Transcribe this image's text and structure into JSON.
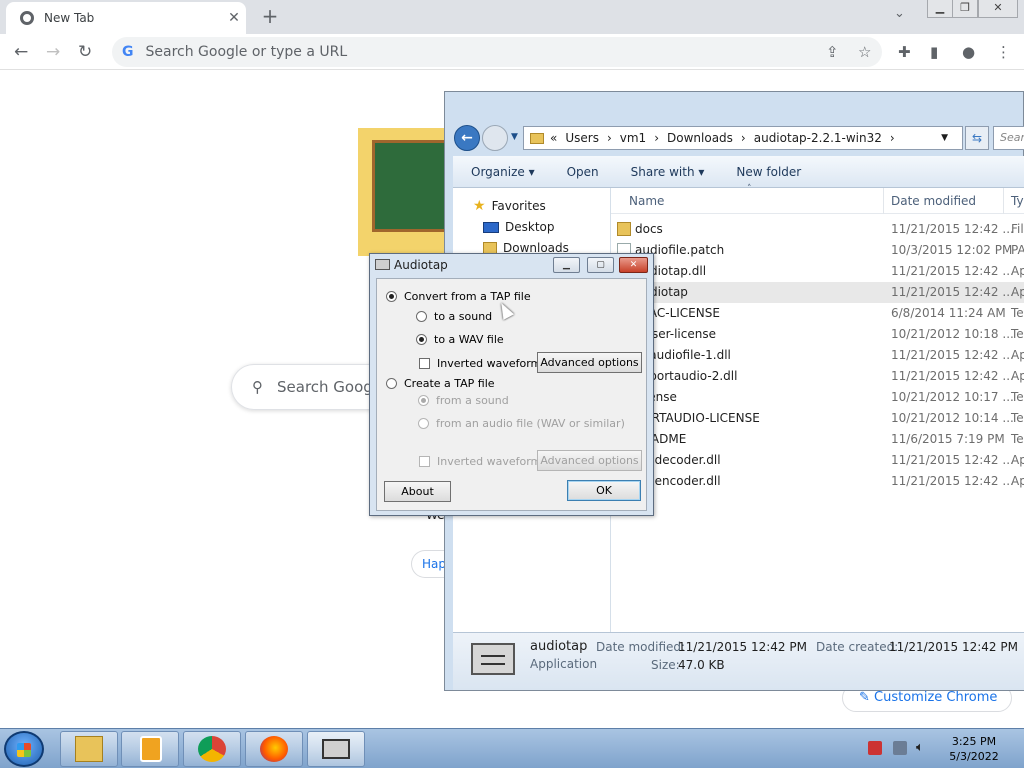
{
  "browser": {
    "tab_title": "New Tab",
    "tab_close": "✕",
    "new_tab": "+",
    "tab_menu": "⌄",
    "omnibox_placeholder": "Search Google or type a URL",
    "ntp_search_placeholder": "Search Goog",
    "peek_text": "We",
    "peek_chip": "Hap",
    "customize_label": "Customize Chrome"
  },
  "explorer": {
    "breadcrumb": [
      "«",
      "Users",
      "›",
      "vm1",
      "›",
      "Downloads",
      "›",
      "audiotap-2.2.1-win32",
      "›"
    ],
    "search_placeholder": "Search",
    "toolbar": [
      "Organize ▾",
      "Open",
      "Share with ▾",
      "New folder"
    ],
    "nav": {
      "favorites": "Favorites",
      "desktop": "Desktop",
      "downloads": "Downloads"
    },
    "columns": {
      "name": "Name",
      "date": "Date modified",
      "type": "Ty"
    },
    "files": [
      {
        "name": "docs",
        "date": "11/21/2015 12:42 ...",
        "type": "File",
        "icon": "folder"
      },
      {
        "name": "audiofile.patch",
        "date": "10/3/2015 12:02 PM",
        "type": "PA",
        "icon": "doc"
      },
      {
        "name": "audiotap.dll",
        "date": "11/21/2015 12:42 ...",
        "type": "Ap",
        "icon": "doc"
      },
      {
        "name": "audiotap",
        "date": "11/21/2015 12:42 ...",
        "type": "Ap",
        "icon": "app",
        "selected": true
      },
      {
        "name": "FLAC-LICENSE",
        "date": "6/8/2014 11:24 AM",
        "type": "Te",
        "icon": "doc"
      },
      {
        "name": "lesser-license",
        "date": "10/21/2012 10:18 ...",
        "type": "Te",
        "icon": "doc"
      },
      {
        "name": "libaudiofile-1.dll",
        "date": "11/21/2015 12:42 ...",
        "type": "Ap",
        "icon": "doc"
      },
      {
        "name": "libportaudio-2.dll",
        "date": "11/21/2015 12:42 ...",
        "type": "Ap",
        "icon": "doc"
      },
      {
        "name": "license",
        "date": "10/21/2012 10:17 ...",
        "type": "Te",
        "icon": "doc"
      },
      {
        "name": "PORTAUDIO-LICENSE",
        "date": "10/21/2012 10:14 ...",
        "type": "Te",
        "icon": "doc"
      },
      {
        "name": "README",
        "date": "11/6/2015 7:19 PM",
        "type": "Te",
        "icon": "doc"
      },
      {
        "name": "tapdecoder.dll",
        "date": "11/21/2015 12:42 ...",
        "type": "Ap",
        "icon": "doc"
      },
      {
        "name": "tapencoder.dll",
        "date": "11/21/2015 12:42 ...",
        "type": "Ap",
        "icon": "doc"
      }
    ],
    "details": {
      "name": "audiotap",
      "type": "Application",
      "modified_label": "Date modified:",
      "modified_value": "11/21/2015 12:42 PM",
      "created_label": "Date created:",
      "created_value": "11/21/2015 12:42 PM",
      "size_label": "Size:",
      "size_value": "47.0 KB"
    }
  },
  "dialog": {
    "title": "Audiotap",
    "minimize": "▁",
    "maximize": "▢",
    "close": "✕",
    "convert_from_tap": "Convert from a TAP file",
    "to_sound": "to a sound",
    "to_wav": "to a WAV file",
    "inverted_waveform": "Inverted waveform",
    "advanced_options": "Advanced options",
    "create_tap": "Create a TAP file",
    "from_sound": "from a sound",
    "from_audio_file": "from an audio file (WAV or similar)",
    "inverted_waveform_2": "Inverted waveform",
    "advanced_options_2": "Advanced options",
    "about": "About",
    "ok": "OK"
  },
  "taskbar": {
    "time": "3:25 PM",
    "date": "5/3/2022"
  }
}
